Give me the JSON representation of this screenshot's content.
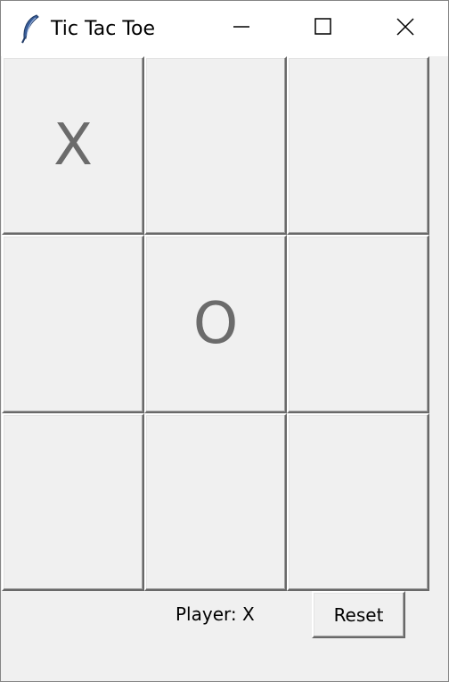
{
  "window": {
    "title": "Tic Tac Toe",
    "app_icon": "feather-icon",
    "controls": [
      "minimize-icon",
      "maximize-icon",
      "close-icon"
    ]
  },
  "board": {
    "cells": [
      "X",
      "",
      "",
      "",
      "O",
      "",
      "",
      "",
      ""
    ]
  },
  "status": {
    "text": "Player: X"
  },
  "actions": {
    "reset_label": "Reset"
  },
  "colors": {
    "mark": "#6b6b6b",
    "background": "#f0f0f0",
    "titlebar": "#ffffff"
  }
}
